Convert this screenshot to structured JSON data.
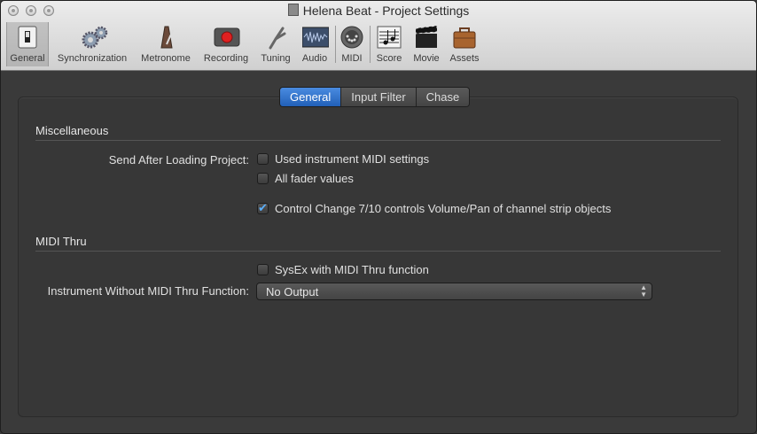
{
  "window": {
    "title": "Helena Beat - Project Settings"
  },
  "toolbar": {
    "items": [
      {
        "label": "General",
        "icon": "switch-icon",
        "selected": true
      },
      {
        "label": "Synchronization",
        "icon": "gears-icon"
      },
      {
        "label": "Metronome",
        "icon": "metronome-icon"
      },
      {
        "label": "Recording",
        "icon": "record-icon"
      },
      {
        "label": "Tuning",
        "icon": "tuning-fork-icon"
      },
      {
        "label": "Audio",
        "icon": "waveform-icon"
      },
      {
        "label": "MIDI",
        "icon": "midi-port-icon"
      },
      {
        "label": "Score",
        "icon": "score-icon"
      },
      {
        "label": "Movie",
        "icon": "clapperboard-icon"
      },
      {
        "label": "Assets",
        "icon": "briefcase-icon"
      }
    ]
  },
  "tabs": [
    {
      "label": "General",
      "active": true
    },
    {
      "label": "Input Filter",
      "active": false
    },
    {
      "label": "Chase",
      "active": false
    }
  ],
  "misc": {
    "heading": "Miscellaneous",
    "send_label": "Send After Loading Project:",
    "options": [
      {
        "label": "Used instrument MIDI settings",
        "checked": false
      },
      {
        "label": "All fader values",
        "checked": false
      },
      {
        "label": "Control Change 7/10 controls Volume/Pan of channel strip objects",
        "checked": true
      }
    ]
  },
  "thru": {
    "heading": "MIDI Thru",
    "sysex_label": "SysEx with MIDI Thru function",
    "sysex_checked": false,
    "instrument_label": "Instrument Without MIDI Thru Function:",
    "instrument_value": "No Output"
  },
  "colors": {
    "accent": "#2f74d0",
    "background": "#3a3a3a"
  }
}
